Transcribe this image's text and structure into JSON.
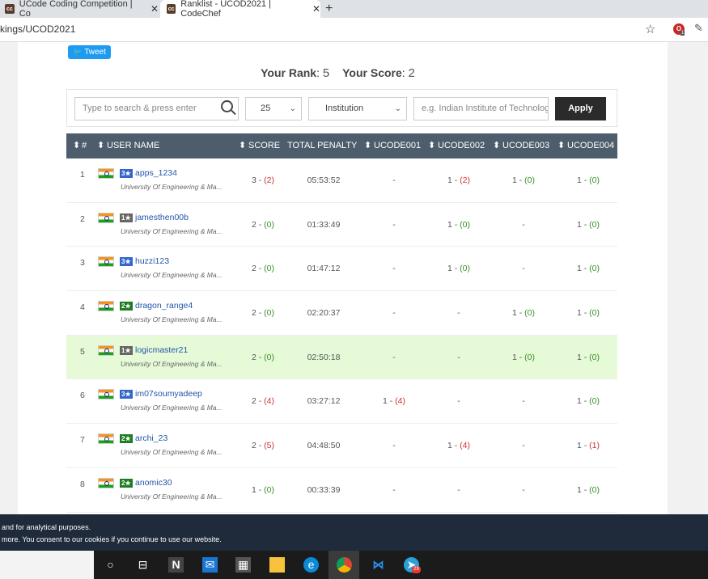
{
  "browser": {
    "tabs": [
      {
        "favicon": "cc",
        "title": "UCode Coding Competition | Co"
      },
      {
        "favicon": "cc",
        "title": "Ranklist - UCOD2021 | CodeChef"
      }
    ],
    "url": "kings/UCOD2021"
  },
  "page": {
    "tweet_label": "Tweet",
    "rank_label": "Your Rank",
    "rank_value": "5",
    "score_label": "Your Score",
    "score_value": "2",
    "search_placeholder": "Type to search & press enter",
    "rows_select": "25",
    "institution_select": "Institution",
    "institution_placeholder": "e.g. Indian Institute of Technolog",
    "apply_label": "Apply",
    "columns": [
      "#",
      "USER NAME",
      "SCORE",
      "TOTAL PENALTY",
      "UCODE001",
      "UCODE002",
      "UCODE003",
      "UCODE004"
    ],
    "rows": [
      {
        "rank": "1",
        "stars": "3★",
        "star_color": "#3366cc",
        "user": "apps_1234",
        "inst": "University Of Engineering & Ma...",
        "score": "3",
        "score_pen": "(2)",
        "penalty": "05:53:52",
        "p1": "-",
        "p2": "1 - ",
        "p2p": "(2)",
        "p3": "1 - ",
        "p3p": "(0)",
        "p4": "1 - ",
        "p4p": "(0)"
      },
      {
        "rank": "2",
        "stars": "1★",
        "star_color": "#666666",
        "user": "jamesthen00b",
        "inst": "University Of Engineering & Ma...",
        "score": "2",
        "score_pen": "(0)",
        "penalty": "01:33:49",
        "p1": "-",
        "p2": "1 - ",
        "p2p": "(0)",
        "p3": "-",
        "p3p": "",
        "p4": "1 - ",
        "p4p": "(0)"
      },
      {
        "rank": "3",
        "stars": "3★",
        "star_color": "#3366cc",
        "user": "huzzi123",
        "inst": "University Of Engineering & Ma...",
        "score": "2",
        "score_pen": "(0)",
        "penalty": "01:47:12",
        "p1": "-",
        "p2": "1 - ",
        "p2p": "(0)",
        "p3": "-",
        "p3p": "",
        "p4": "1 - ",
        "p4p": "(0)"
      },
      {
        "rank": "4",
        "stars": "2★",
        "star_color": "#1e7d22",
        "user": "dragon_range4",
        "inst": "University Of Engineering & Ma...",
        "score": "2",
        "score_pen": "(0)",
        "penalty": "02:20:37",
        "p1": "-",
        "p2": "-",
        "p2p": "",
        "p3": "1 - ",
        "p3p": "(0)",
        "p4": "1 - ",
        "p4p": "(0)"
      },
      {
        "rank": "5",
        "stars": "1★",
        "star_color": "#666666",
        "user": "logicmaster21",
        "inst": "University Of Engineering & Ma...",
        "score": "2",
        "score_pen": "(0)",
        "penalty": "02:50:18",
        "p1": "-",
        "p2": "-",
        "p2p": "",
        "p3": "1 - ",
        "p3p": "(0)",
        "p4": "1 - ",
        "p4p": "(0)"
      },
      {
        "rank": "6",
        "stars": "3★",
        "star_color": "#3366cc",
        "user": "im07soumyadeep",
        "inst": "University Of Engineering & Ma...",
        "score": "2",
        "score_pen": "(4)",
        "penalty": "03:27:12",
        "p1": "1 - ",
        "p1p": "(4)",
        "p2": "-",
        "p2p": "",
        "p3": "-",
        "p3p": "",
        "p4": "1 - ",
        "p4p": "(0)"
      },
      {
        "rank": "7",
        "stars": "2★",
        "star_color": "#1e7d22",
        "user": "archi_23",
        "inst": "University Of Engineering & Ma...",
        "score": "2",
        "score_pen": "(5)",
        "penalty": "04:48:50",
        "p1": "-",
        "p2": "1 - ",
        "p2p": "(4)",
        "p3": "-",
        "p3p": "",
        "p4": "1 - ",
        "p4p": "(1)"
      },
      {
        "rank": "8",
        "stars": "2★",
        "star_color": "#1e7d22",
        "user": "anomic30",
        "inst": "University Of Engineering & Ma...",
        "score": "1",
        "score_pen": "(0)",
        "penalty": "00:33:39",
        "p1": "-",
        "p2": "-",
        "p2p": "",
        "p3": "-",
        "p3p": "",
        "p4": "1 - ",
        "p4p": "(0)"
      }
    ]
  },
  "cookie": {
    "line1": "and for analytical purposes.",
    "line2": "more. You consent to our cookies if you continue to use our website."
  },
  "taskbar": {
    "icons": [
      "cortana-icon",
      "task-view-icon",
      "n-app-icon",
      "mail-icon",
      "store-icon",
      "file-explorer-icon",
      "edge-icon",
      "chrome-icon",
      "vscode-icon",
      "telegram-icon"
    ],
    "telegram_badge": "29"
  }
}
